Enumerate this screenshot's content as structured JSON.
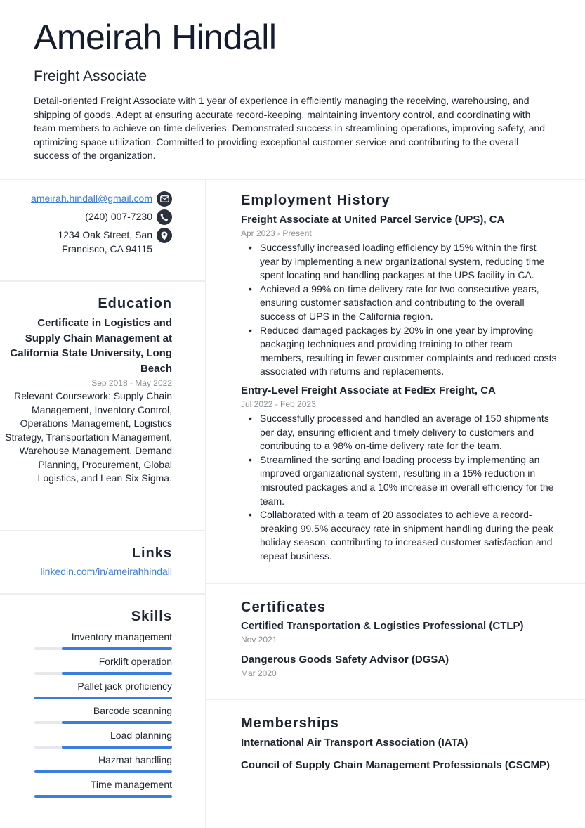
{
  "header": {
    "name": "Ameirah Hindall",
    "title": "Freight Associate",
    "summary": "Detail-oriented Freight Associate with 1 year of experience in efficiently managing the receiving, warehousing, and shipping of goods. Adept at ensuring accurate record-keeping, maintaining inventory control, and coordinating with team members to achieve on-time deliveries. Demonstrated success in streamlining operations, improving safety, and optimizing space utilization. Committed to providing exceptional customer service and contributing to the overall success of the organization."
  },
  "contact": {
    "email": "ameirah.hindall@gmail.com",
    "email_icon": "envelope-icon",
    "phone": "(240) 007-7230",
    "phone_icon": "phone-icon",
    "address": "1234 Oak Street, San Francisco, CA 94115",
    "address_icon": "map-pin-icon"
  },
  "education": {
    "heading": "Education",
    "title": "Certificate in Logistics and Supply Chain Management at California State University, Long Beach",
    "dates": "Sep 2018 - May 2022",
    "description": "Relevant Coursework: Supply Chain Management, Inventory Control, Operations Management, Logistics Strategy, Transportation Management, Warehouse Management, Demand Planning, Procurement, Global Logistics, and Lean Six Sigma."
  },
  "links": {
    "heading": "Links",
    "items": [
      {
        "label": "linkedin.com/in/ameirahhindall"
      }
    ]
  },
  "skills": {
    "heading": "Skills",
    "accent": "#3b7ddd",
    "items": [
      {
        "name": "Inventory management",
        "level": 0.8
      },
      {
        "name": "Forklift operation",
        "level": 0.8
      },
      {
        "name": "Pallet jack proficiency",
        "level": 1.0
      },
      {
        "name": "Barcode scanning",
        "level": 0.8
      },
      {
        "name": "Load planning",
        "level": 0.8
      },
      {
        "name": "Hazmat handling",
        "level": 1.0
      },
      {
        "name": "Time management",
        "level": 1.0
      }
    ]
  },
  "employment": {
    "heading": "Employment History",
    "jobs": [
      {
        "title": "Freight Associate at United Parcel Service (UPS), CA",
        "dates": "Apr 2023 - Present",
        "bullets": [
          "Successfully increased loading efficiency by 15% within the first year by implementing a new organizational system, reducing time spent locating and handling packages at the UPS facility in CA.",
          "Achieved a 99% on-time delivery rate for two consecutive years, ensuring customer satisfaction and contributing to the overall success of UPS in the California region.",
          "Reduced damaged packages by 20% in one year by improving packaging techniques and providing training to other team members, resulting in fewer customer complaints and reduced costs associated with returns and replacements."
        ]
      },
      {
        "title": "Entry-Level Freight Associate at FedEx Freight, CA",
        "dates": "Jul 2022 - Feb 2023",
        "bullets": [
          "Successfully processed and handled an average of 150 shipments per day, ensuring efficient and timely delivery to customers and contributing to a 98% on-time delivery rate for the team.",
          "Streamlined the sorting and loading process by implementing an improved organizational system, resulting in a 15% reduction in misrouted packages and a 10% increase in overall efficiency for the team.",
          "Collaborated with a team of 20 associates to achieve a record-breaking 99.5% accuracy rate in shipment handling during the peak holiday season, contributing to increased customer satisfaction and repeat business."
        ]
      }
    ]
  },
  "certificates": {
    "heading": "Certificates",
    "items": [
      {
        "title": "Certified Transportation & Logistics Professional (CTLP)",
        "date": "Nov 2021"
      },
      {
        "title": "Dangerous Goods Safety Advisor (DGSA)",
        "date": "Mar 2020"
      }
    ]
  },
  "memberships": {
    "heading": "Memberships",
    "items": [
      "International Air Transport Association (IATA)",
      "Council of Supply Chain Management Professionals (CSCMP)"
    ]
  }
}
